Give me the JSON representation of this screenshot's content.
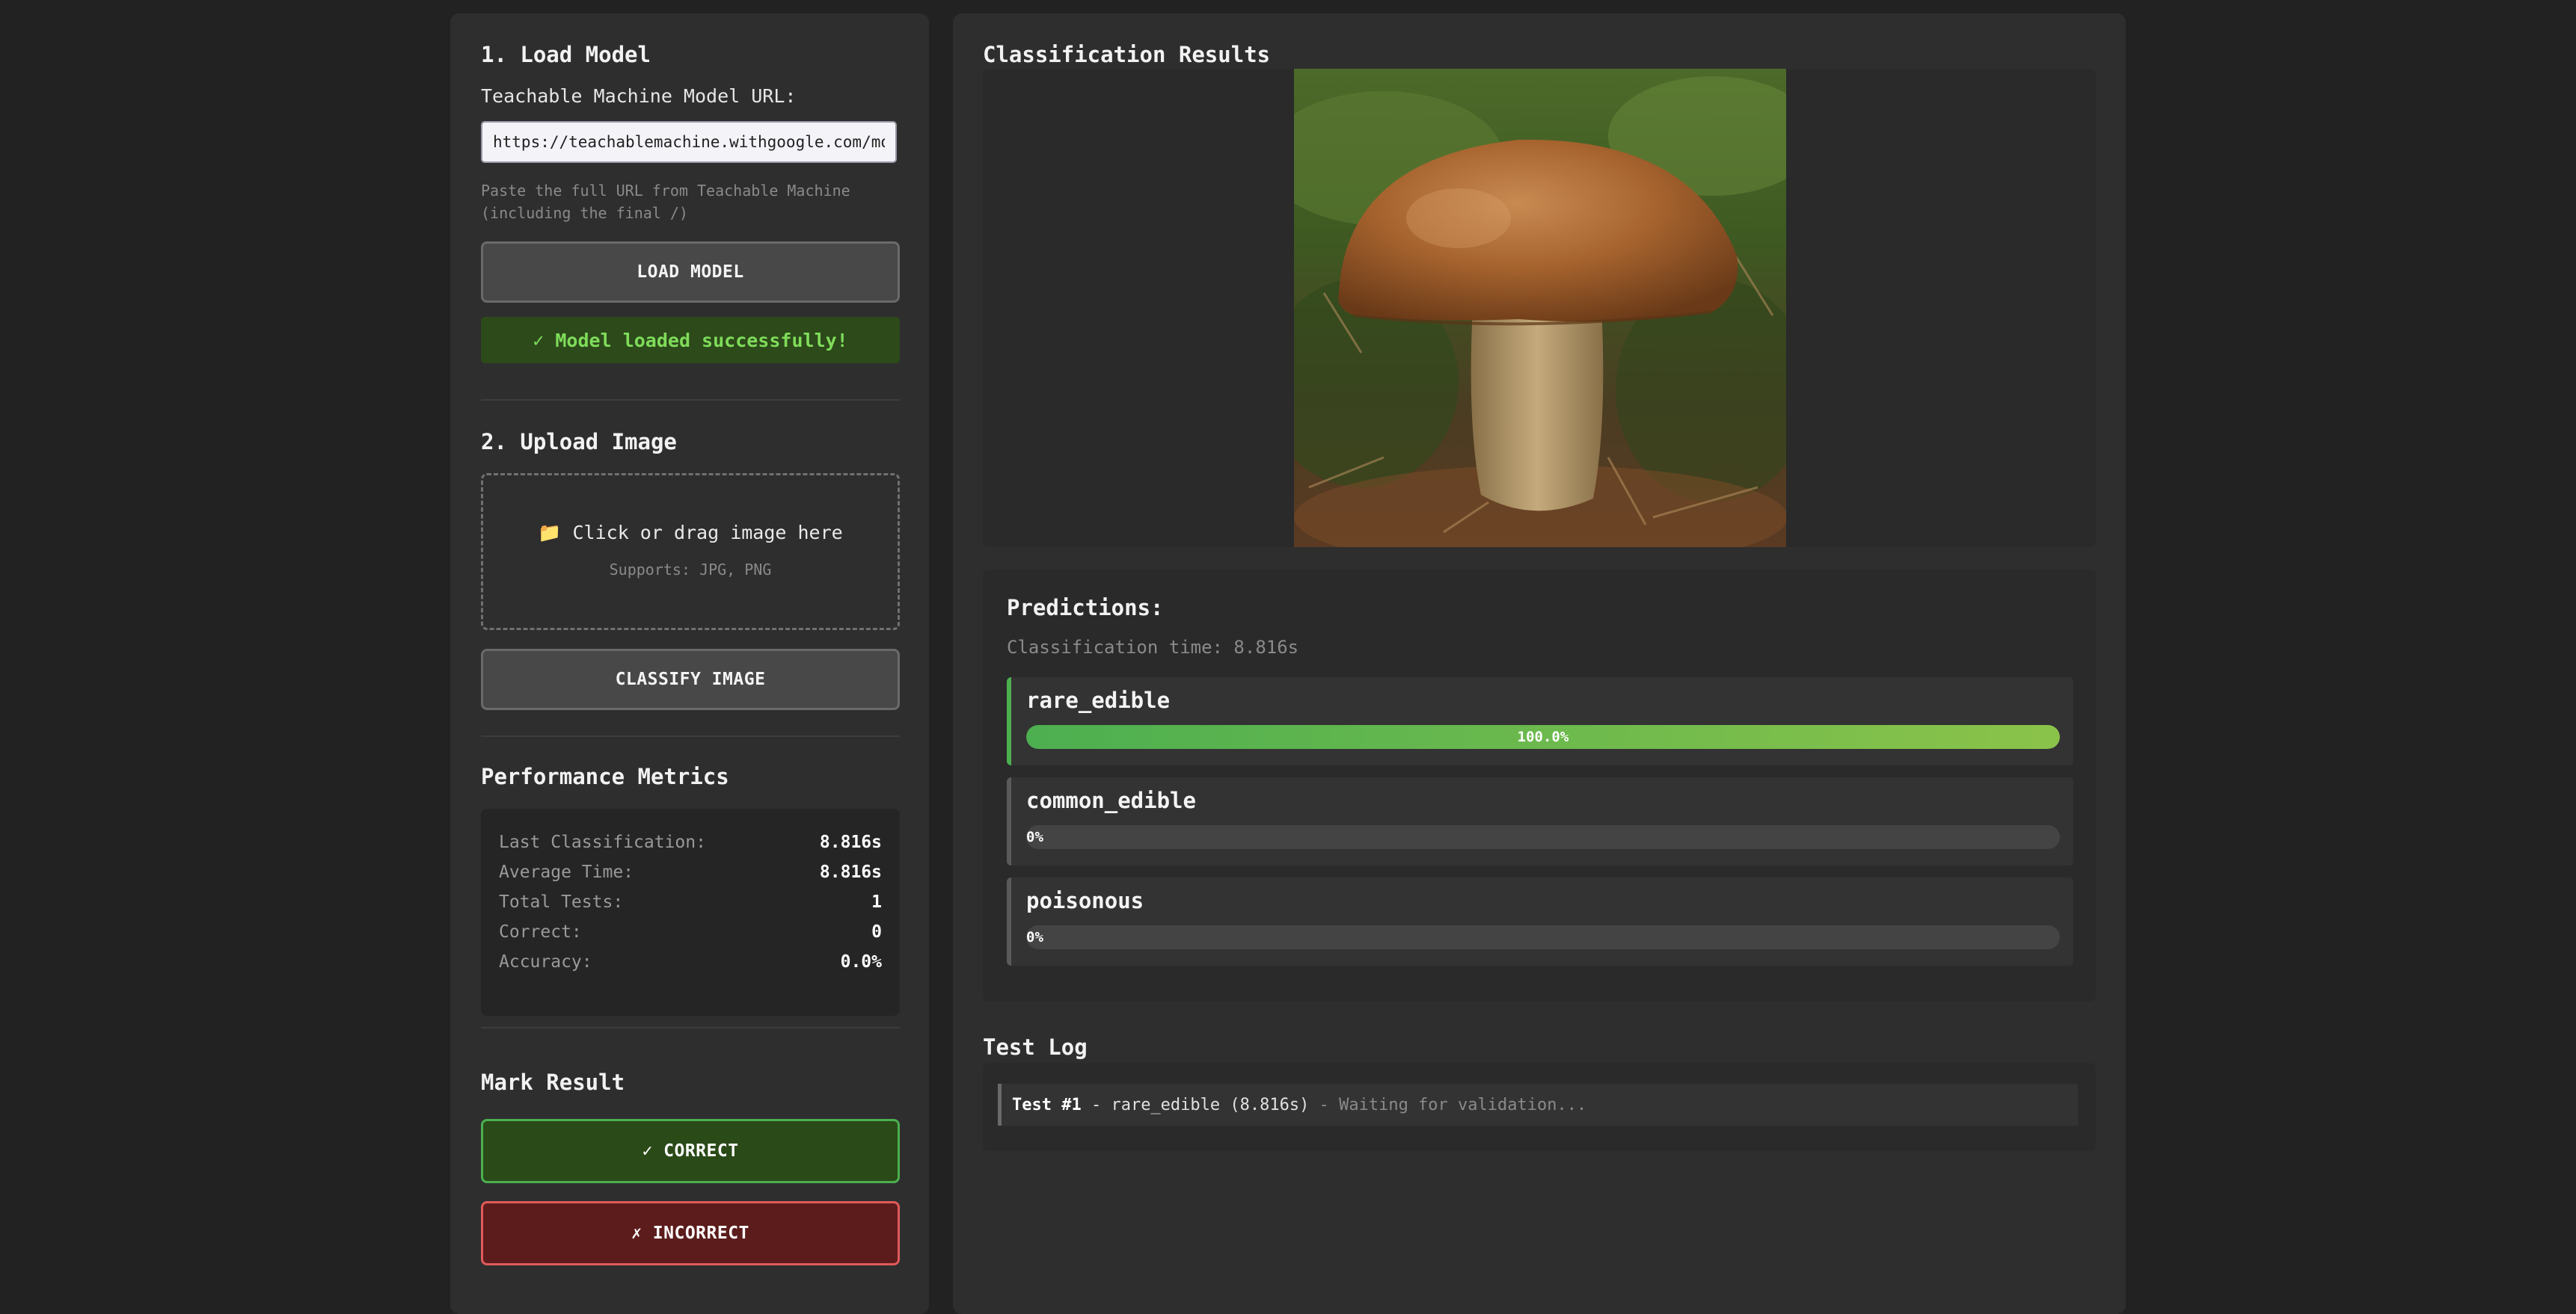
{
  "load_section": {
    "title": "1. Load Model",
    "url_label": "Teachable Machine Model URL:",
    "url_value": "https://teachablemachine.withgoogle.com/models/",
    "hint_line1": "Paste the full URL from Teachable Machine",
    "hint_line2": "(including the final /)",
    "load_button": "LOAD MODEL",
    "status": "✓ Model loaded successfully!"
  },
  "upload_section": {
    "title": "2. Upload Image",
    "dropzone_icon": "📁",
    "dropzone_text": "Click or drag image here",
    "dropzone_sub": "Supports: JPG, PNG",
    "classify_button": "CLASSIFY IMAGE"
  },
  "metrics": {
    "title": "Performance Metrics",
    "rows": [
      {
        "label": "Last Classification:",
        "value": "8.816s"
      },
      {
        "label": "Average Time:",
        "value": "8.816s"
      },
      {
        "label": "Total Tests:",
        "value": "1"
      },
      {
        "label": "Correct:",
        "value": "0"
      },
      {
        "label": "Accuracy:",
        "value": "0.0%"
      }
    ]
  },
  "mark_result": {
    "title": "Mark Result",
    "correct_button": "✓ CORRECT",
    "incorrect_button": "✗ INCORRECT"
  },
  "results": {
    "title": "Classification Results",
    "predictions_title": "Predictions:",
    "classification_time": "Classification time: 8.816s",
    "predictions": [
      {
        "label": "rare_edible",
        "percent_text": "100.0%",
        "fraction": 1.0
      },
      {
        "label": "common_edible",
        "percent_text": "0%",
        "fraction": 0
      },
      {
        "label": "poisonous",
        "percent_text": "0%",
        "fraction": 0
      }
    ]
  },
  "test_log": {
    "title": "Test Log",
    "entries": [
      {
        "test": "Test #1",
        "detail": " - rare_edible (8.816s)",
        "status": " - Waiting for validation..."
      }
    ]
  },
  "colors": {
    "accent_green": "#4caf50",
    "success_text": "#7fdc5a",
    "danger_border": "#e05a5a"
  }
}
